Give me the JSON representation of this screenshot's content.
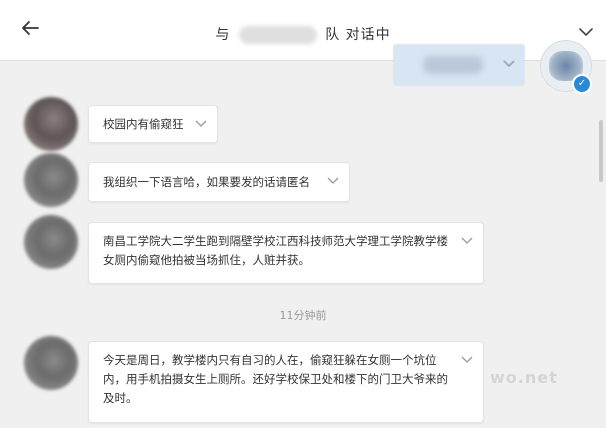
{
  "header": {
    "title_prefix": "与",
    "title_partial": "队",
    "title_suffix": "对话中"
  },
  "messages": [
    {
      "text": "校园内有偷窥狂"
    },
    {
      "text": "我组织一下语言哈，如果要发的话请匿名"
    },
    {
      "text": "南昌工学院大二学生跑到隔壁学校江西科技师范大学理工学院教学楼女厕内偷窥他拍被当场抓住，人赃并获。"
    },
    {
      "text": "今天是周日，教学楼内只有自习的人在，偷窥狂躲在女厕一个坑位内，用手机拍摄女生上厕所。还好学校保卫处和楼下的门卫大爷来的及时。"
    }
  ],
  "timestamp": "11分钟前",
  "watermark": "wo.net",
  "icons": {
    "back": "back-arrow-icon",
    "collapse": "chevron-down-icon",
    "verified": "verified-check-icon"
  },
  "colors": {
    "background": "#f0f0f0",
    "bubble": "#ffffff",
    "my_bubble": "#d8e6f3",
    "verified": "#2a89d8"
  }
}
